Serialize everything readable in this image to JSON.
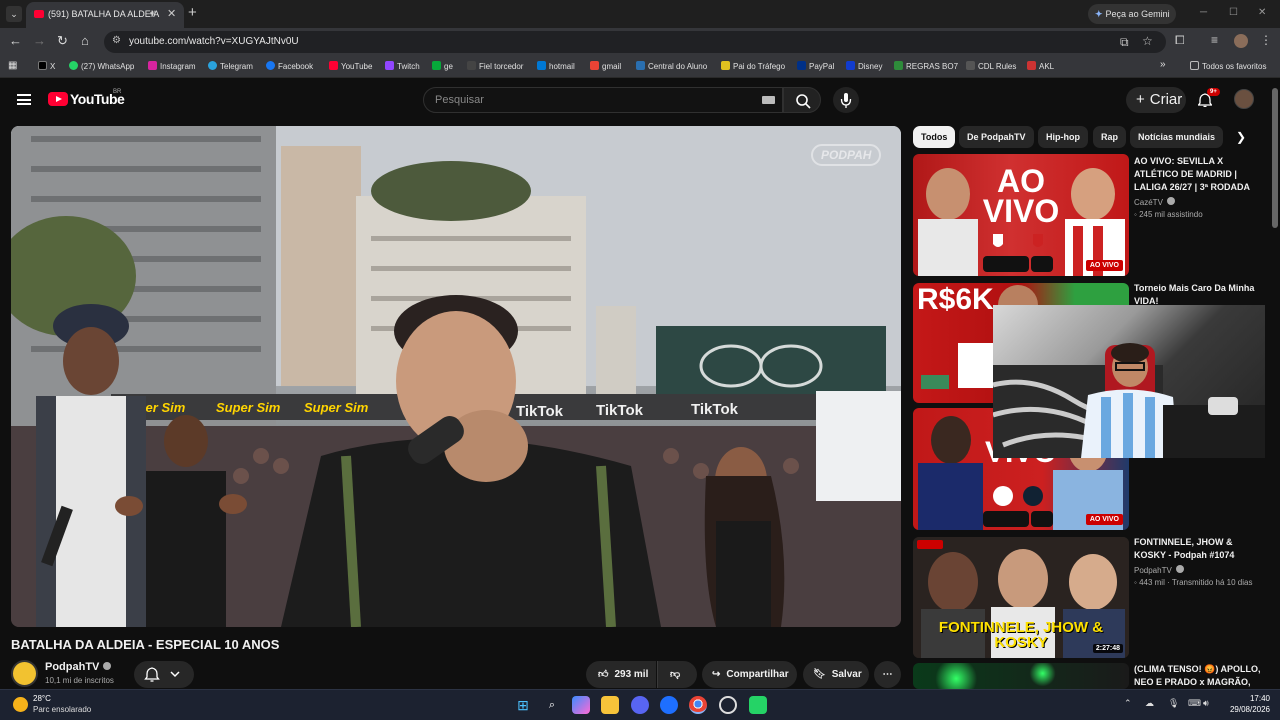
{
  "browser": {
    "tab_title": "(591) BATALHA DA ALDEIA",
    "url": "youtube.com/watch?v=XUGYAJtNv0U",
    "gemini_label": "Peça ao Gemini",
    "bookmarks": [
      "X",
      "(27) WhatsApp",
      "Instagram",
      "Telegram",
      "Facebook",
      "YouTube",
      "Twitch",
      "ge",
      "Fiel torcedor",
      "hotmail",
      "gmail",
      "Central do Aluno",
      "Pai do Tráfego",
      "PayPal",
      "Disney",
      "REGRAS BO7",
      "CDL Rules",
      "AKL"
    ],
    "all_bookmarks": "Todos os favoritos"
  },
  "youtube": {
    "logo_text": "YouTube",
    "country": "BR",
    "search_placeholder": "Pesquisar",
    "create_label": "Criar",
    "notifications": "9+"
  },
  "video": {
    "title": "BATALHA DA ALDEIA - ESPECIAL 10 ANOS",
    "channel": "PodpahTV",
    "subscribers": "10,1 mi de inscritos",
    "likes": "293 mil",
    "share_label": "Compartilhar",
    "save_label": "Salvar",
    "overlay": {
      "watermark": "PODPAH",
      "banner_super": [
        "Super Sim",
        "Super Sim",
        "Super Sim"
      ],
      "banner_tiktok": [
        "TikTok",
        "TikTok",
        "TikTok"
      ]
    }
  },
  "chips": [
    "Todos",
    "De PodpahTV",
    "Hip-hop",
    "Rap",
    "Notícias mundiais"
  ],
  "recommendations": [
    {
      "title": "AO VIVO: SEVILLA X ATLÉTICO DE MADRID | LALIGA 26/27 | 3ª RODADA",
      "channel": "CazéTV",
      "meta": "245 mil assistindo",
      "badge": "AO VIVO",
      "thumb_text": "AO VIVO"
    },
    {
      "title": "Torneio Mais Caro Da Minha VIDA!",
      "channel": "",
      "meta": "",
      "badge": "",
      "thumb_text": "R$6K"
    },
    {
      "title": "",
      "channel": "",
      "meta": "",
      "badge": "AO VIVO",
      "thumb_text": "VIVO"
    },
    {
      "title": "FONTINNELE, JHOW & KOSKY - Podpah #1074",
      "channel": "PodpahTV",
      "meta": "443 mil · Transmitido há 10 dias",
      "badge": "2:27:48",
      "thumb_text": "FONTINNELE, JHOW & KOSKY"
    },
    {
      "title": "(CLIMA TENSO! 😡) APOLLO, NEO E PRADO x MAGRÃO,",
      "channel": "",
      "meta": "",
      "badge": "",
      "thumb_text": ""
    }
  ],
  "taskbar": {
    "temperature": "28°C",
    "condition": "Parc ensolarado",
    "time": "17:40",
    "date": "29/08/2026"
  },
  "colors": {
    "accent": "#ff0033",
    "background": "#0f0f0f",
    "live": "#cc0000"
  }
}
